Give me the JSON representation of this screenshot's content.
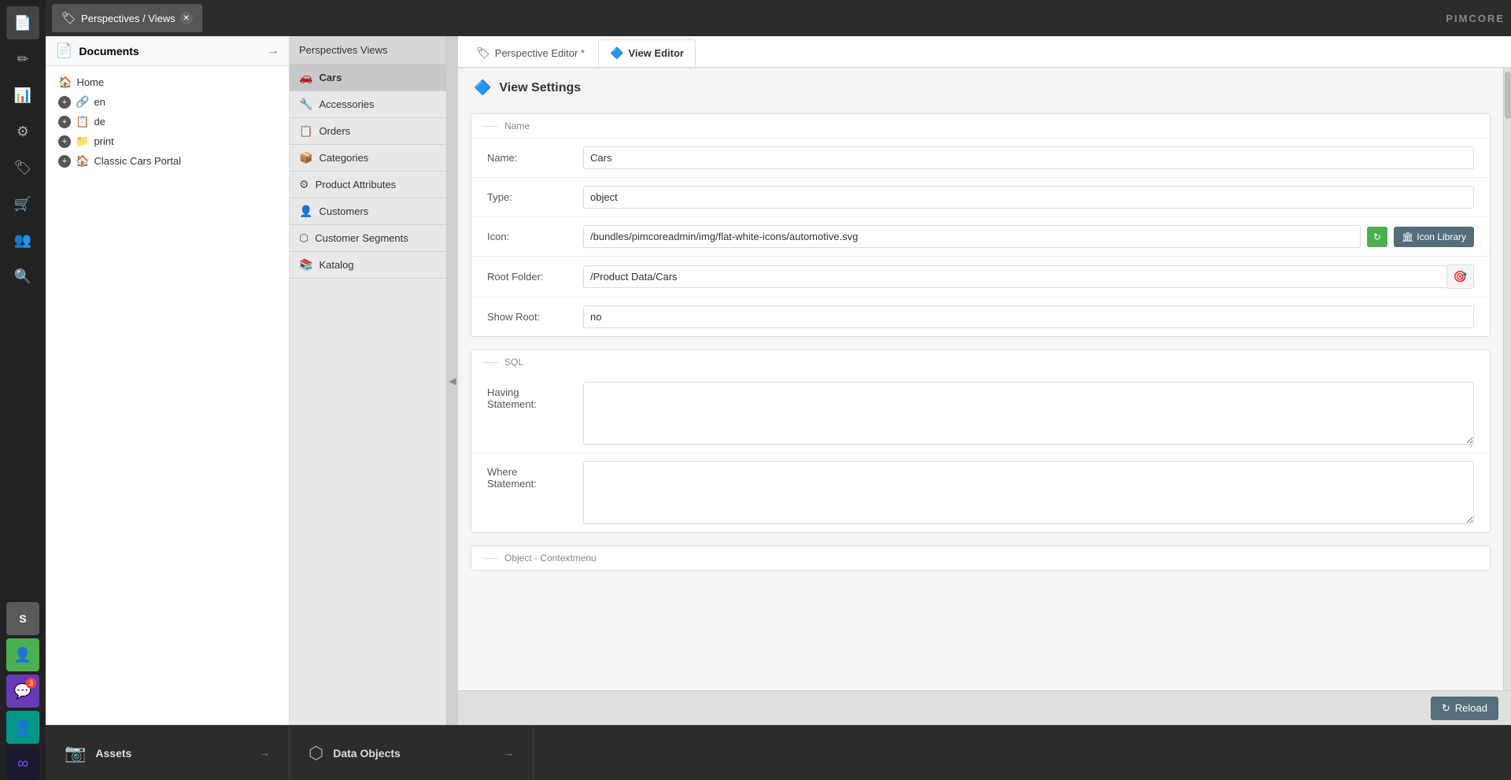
{
  "app": {
    "title": "Pimcore",
    "logo_text": "PIMCORE"
  },
  "sidebar": {
    "icons": [
      {
        "name": "documents-icon",
        "symbol": "📄",
        "label": "Documents",
        "active": true
      },
      {
        "name": "pencil-icon",
        "symbol": "✏",
        "label": "Edit",
        "active": false
      },
      {
        "name": "chart-icon",
        "symbol": "📊",
        "label": "Analytics",
        "active": false
      },
      {
        "name": "settings-icon",
        "symbol": "⚙",
        "label": "Settings",
        "active": false
      },
      {
        "name": "tag-icon",
        "symbol": "🏷",
        "label": "Tags",
        "active": false
      },
      {
        "name": "cart-icon",
        "symbol": "🛒",
        "label": "Shop",
        "active": false
      },
      {
        "name": "users-icon",
        "symbol": "👥",
        "label": "Users",
        "active": false
      },
      {
        "name": "search-icon",
        "symbol": "🔍",
        "label": "Search",
        "active": false
      },
      {
        "name": "symfony-icon",
        "symbol": "Ⓢ",
        "label": "Symfony",
        "active": false,
        "special": "symfony"
      },
      {
        "name": "person-icon",
        "symbol": "👤",
        "label": "Profile",
        "active": false,
        "special": "green"
      },
      {
        "name": "chat-icon",
        "symbol": "💬",
        "label": "Chat",
        "active": false,
        "special": "purple",
        "badge": "3"
      },
      {
        "name": "user2-icon",
        "symbol": "👤",
        "label": "User2",
        "active": false,
        "special": "teal"
      },
      {
        "name": "infinity-icon",
        "symbol": "∞",
        "label": "Infinity",
        "active": false,
        "special": "darkgray"
      }
    ]
  },
  "top_tabbar": {
    "tabs": [
      {
        "id": "perspectives",
        "label": "Perspectives / Views",
        "icon": "🏷",
        "active": true,
        "closable": true
      }
    ]
  },
  "documents_panel": {
    "title": "Documents",
    "title_icon": "📄",
    "tree_items": [
      {
        "label": "Home",
        "icon": "🏠",
        "type": "home",
        "has_plus": false
      },
      {
        "label": "en",
        "icon": "🔗",
        "type": "link",
        "has_plus": true,
        "icon_color": "blue"
      },
      {
        "label": "de",
        "icon": "📋",
        "type": "page",
        "has_plus": true,
        "icon_color": "blue"
      },
      {
        "label": "print",
        "icon": "📁",
        "type": "folder",
        "has_plus": true,
        "icon_color": "orange"
      },
      {
        "label": "Classic Cars Portal",
        "icon": "🏠",
        "type": "home",
        "has_plus": true
      }
    ]
  },
  "perspectives_panel": {
    "header": "Perspectives Views",
    "items": [
      {
        "label": "Cars",
        "icon": "🚗",
        "active": true
      },
      {
        "label": "Accessories",
        "icon": "🔧",
        "active": false
      },
      {
        "label": "Orders",
        "icon": "📋",
        "active": false
      },
      {
        "label": "Categories",
        "icon": "📦",
        "active": false
      },
      {
        "label": "Product Attributes",
        "icon": "⚙",
        "active": false
      },
      {
        "label": "Customers",
        "icon": "👤",
        "active": false
      },
      {
        "label": "Customer Segments",
        "icon": "⬡",
        "active": false
      },
      {
        "label": "Katalog",
        "icon": "📚",
        "active": false
      }
    ]
  },
  "editor": {
    "tabs": [
      {
        "id": "perspective",
        "label": "Perspective Editor *",
        "icon": "🏷",
        "active": false
      },
      {
        "id": "view",
        "label": "View Editor",
        "icon": "🔷",
        "active": true
      }
    ],
    "view_settings": {
      "title": "View Settings",
      "title_icon": "🔷",
      "name_section": {
        "label": "Name",
        "fields": [
          {
            "label": "Name:",
            "value": "Cars",
            "type": "text",
            "name": "name-field"
          },
          {
            "label": "Type:",
            "value": "object",
            "type": "text",
            "name": "type-field"
          },
          {
            "label": "Icon:",
            "value": "/bundles/pimcoreadmin/img/flat-white-icons/automotive.svg",
            "type": "icon",
            "name": "icon-field"
          },
          {
            "label": "Root Folder:",
            "value": "/Product Data/Cars",
            "type": "folder",
            "name": "root-folder-field"
          },
          {
            "label": "Show Root:",
            "value": "no",
            "type": "text",
            "name": "show-root-field"
          }
        ]
      },
      "sql_section": {
        "label": "SQL",
        "fields": [
          {
            "label": "Having\nStatement:",
            "value": "",
            "name": "having-statement-field"
          },
          {
            "label": "Where\nStatement:",
            "value": "",
            "name": "where-statement-field"
          }
        ]
      },
      "context_section": {
        "label": "Object - Contextmenu"
      }
    },
    "buttons": {
      "reload_label": "Reload",
      "refresh_icon": "↻",
      "icon_library_label": "Icon Library",
      "icon_library_icon": "🏛"
    }
  },
  "bottom_panels": [
    {
      "label": "Assets",
      "icon": "📷"
    },
    {
      "label": "Data Objects",
      "icon": "⬡"
    }
  ]
}
